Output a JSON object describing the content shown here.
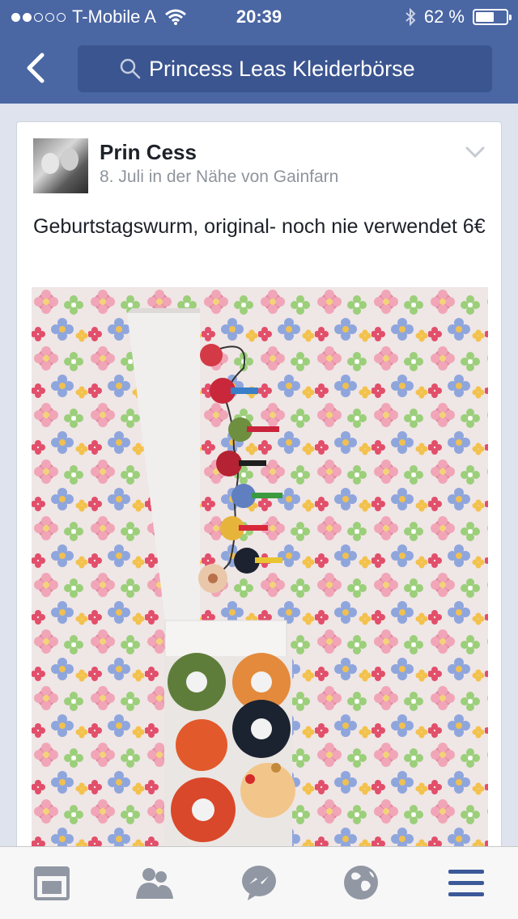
{
  "status_bar": {
    "carrier": "T-Mobile A",
    "time": "20:39",
    "battery_text": "62 %",
    "battery_level": 0.62,
    "signal_bars_filled": 2,
    "signal_bars_total": 5
  },
  "nav": {
    "back_icon": "chevron-left-icon",
    "search_value": "Princess Leas Kleiderbörse"
  },
  "post": {
    "author": "Prin Cess",
    "meta": "8. Juli in der Nähe von Gainfarn",
    "text": "Geburtstagswurm, original- noch nie verwendet 6€"
  },
  "tabs": [
    {
      "icon": "news-feed-icon",
      "active": false
    },
    {
      "icon": "friends-icon",
      "active": false
    },
    {
      "icon": "messenger-icon",
      "active": false
    },
    {
      "icon": "globe-icon",
      "active": false
    },
    {
      "icon": "menu-icon",
      "active": true
    }
  ],
  "colors": {
    "brand_blue": "#4a66a3",
    "search_bg": "#3b5590",
    "tab_active": "#3b5998",
    "tab_inactive": "#9197a3"
  }
}
